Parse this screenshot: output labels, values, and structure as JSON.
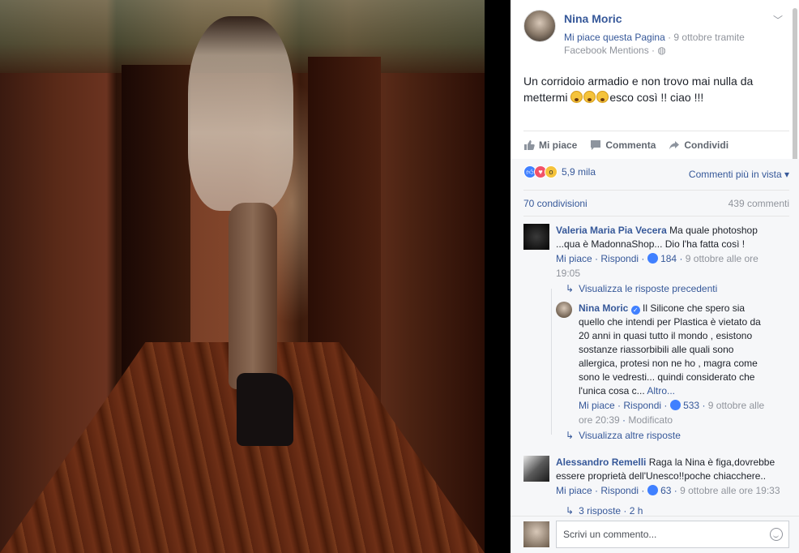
{
  "post": {
    "author": "Nina Moric",
    "like_page": "Mi piace questa Pagina",
    "meta_date": " · 9 ottobre tramite",
    "meta_source": "Facebook Mentions · ",
    "text_line1": "Un corridoio armadio e non trovo mai nulla da",
    "text_line2_before": "mettermi ",
    "text_line2_after": "esco così !! ciao !!!"
  },
  "actions": {
    "like": "Mi piace",
    "comment": "Commenta",
    "share": "Condividi"
  },
  "reactions": {
    "count": "5,9 mila",
    "sort": "Commenti più in vista ▾",
    "shares": "70 condivisioni",
    "comments": "439 commenti"
  },
  "comments": [
    {
      "name": "Valeria Maria Pia Vecera",
      "text": " Ma quale photoshop ...qua è MadonnaShop... Dio l'ha fatta così !",
      "like": "Mi piace",
      "reply": "Rispondi",
      "likes": "184",
      "time": "9 ottobre alle ore 19:05"
    },
    {
      "name": "Nina Moric",
      "text": " Il Silicone che spero sia quello che intendi per Plastica è vietato da 20 anni in quasi tutto il mondo , esistono sostanze riassorbibili alle quali sono allergica, protesi non ne ho , magra come sono le vedresti... quindi considerato che l'unica cosa c... ",
      "more": "Altro...",
      "like": "Mi piace",
      "reply": "Rispondi",
      "likes": "533",
      "time": "9 ottobre alle ore 20:39",
      "edited": "Modificato"
    },
    {
      "name": "Alessandro Remelli",
      "text": " Raga la Nina è figa,dovrebbe essere proprietà dell'Unesco!!poche chiacchere..",
      "like": "Mi piace",
      "reply": "Rispondi",
      "likes": "63",
      "time": "9 ottobre alle ore 19:33"
    }
  ],
  "thread": {
    "prev_replies": "Visualizza le risposte precedenti",
    "more_replies": "Visualizza altre risposte",
    "replies_count": "3 risposte · 2 h"
  },
  "composer": {
    "placeholder": "Scrivi un commento..."
  },
  "colors": {
    "link": "#365899",
    "muted": "#90949c",
    "like_blue": "#4080ff"
  }
}
